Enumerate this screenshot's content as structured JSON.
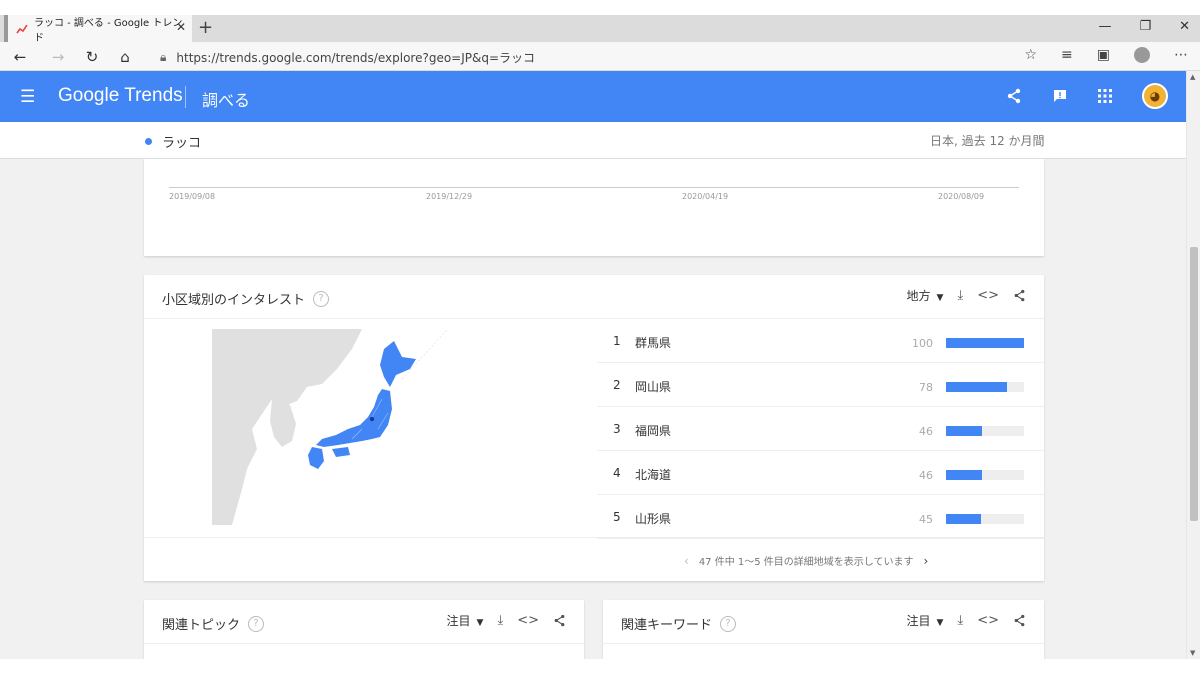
{
  "browser": {
    "tab_title": "ラッコ - 調べる - Google トレンド",
    "url": "https://trends.google.com/trends/explore?geo=JP&q=ラッコ"
  },
  "app": {
    "brand": "Google Trends",
    "section": "調べる"
  },
  "term_bar": {
    "term": "ラッコ",
    "scope": "日本, 過去 12 か月間"
  },
  "timeline": {
    "dates": [
      "2019/09/08",
      "2019/12/29",
      "2020/04/19",
      "2020/08/09"
    ]
  },
  "region_card": {
    "title": "小区域別のインタレスト",
    "resolution": "地方",
    "rows": [
      {
        "rank": "1",
        "name": "群馬県",
        "value": "100",
        "level": 100
      },
      {
        "rank": "2",
        "name": "岡山県",
        "value": "78",
        "level": 78
      },
      {
        "rank": "3",
        "name": "福岡県",
        "value": "46",
        "level": 46
      },
      {
        "rank": "4",
        "name": "北海道",
        "value": "46",
        "level": 46
      },
      {
        "rank": "5",
        "name": "山形県",
        "value": "45",
        "level": 45
      }
    ],
    "pager": "47 件中 1～5 件目の詳細地域を表示しています"
  },
  "topics_card": {
    "title": "関連トピック",
    "filter": "注目"
  },
  "queries_card": {
    "title": "関連キーワード",
    "filter": "注目"
  },
  "colors": {
    "accent": "#4285f4",
    "map_land": "#e0e0e0"
  }
}
